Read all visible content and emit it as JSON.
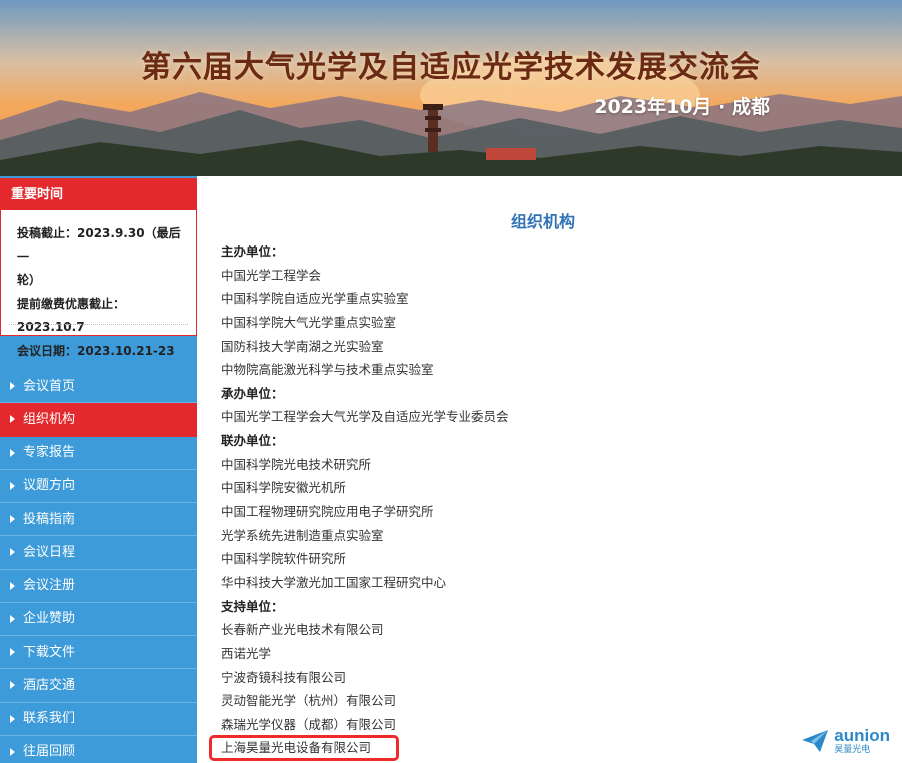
{
  "banner": {
    "title": "第六届大气光学及自适应光学技术发展交流会",
    "subtitle": "2023年10月 · 成都"
  },
  "important_dates": {
    "heading": "重要时间",
    "lines": [
      "投稿截止：2023.9.30（最后一",
      "轮）",
      "提前缴费优惠截止：2023.10.7",
      "会议日期：2023.10.21-23"
    ]
  },
  "menu": {
    "items": [
      {
        "label": "会议首页",
        "active": false
      },
      {
        "label": "组织机构",
        "active": true
      },
      {
        "label": "专家报告",
        "active": false
      },
      {
        "label": "议题方向",
        "active": false
      },
      {
        "label": "投稿指南",
        "active": false
      },
      {
        "label": "会议日程",
        "active": false
      },
      {
        "label": "会议注册",
        "active": false
      },
      {
        "label": "企业赞助",
        "active": false
      },
      {
        "label": "下载文件",
        "active": false
      },
      {
        "label": "酒店交通",
        "active": false
      },
      {
        "label": "联系我们",
        "active": false
      },
      {
        "label": "往届回顾",
        "active": false
      }
    ]
  },
  "main": {
    "title": "组织机构",
    "lines": [
      {
        "text": "主办单位：",
        "heading": true
      },
      {
        "text": "中国光学工程学会"
      },
      {
        "text": "中国科学院自适应光学重点实验室"
      },
      {
        "text": "中国科学院大气光学重点实验室"
      },
      {
        "text": "国防科技大学南湖之光实验室"
      },
      {
        "text": "中物院高能激光科学与技术重点实验室"
      },
      {
        "text": "承办单位：",
        "heading": true
      },
      {
        "text": "中国光学工程学会大气光学及自适应光学专业委员会"
      },
      {
        "text": "联办单位：",
        "heading": true
      },
      {
        "text": "中国科学院光电技术研究所"
      },
      {
        "text": "中国科学院安徽光机所"
      },
      {
        "text": "中国工程物理研究院应用电子学研究所"
      },
      {
        "text": "光学系统先进制造重点实验室"
      },
      {
        "text": "中国科学院软件研究所"
      },
      {
        "text": "华中科技大学激光加工国家工程研究中心"
      },
      {
        "text": "支持单位：",
        "heading": true
      },
      {
        "text": "长春新产业光电技术有限公司"
      },
      {
        "text": "西诺光学"
      },
      {
        "text": "宁波奇镜科技有限公司"
      },
      {
        "text": "灵动智能光学（杭州）有限公司"
      },
      {
        "text": "森瑞光学仪器（成都）有限公司"
      },
      {
        "text": "上海昊量光电设备有限公司",
        "highlight": true
      }
    ]
  },
  "watermark": {
    "word": "aunion",
    "cn": "昊量光电",
    "icon": "paper-plane-logo"
  },
  "colors": {
    "accent_red": "#e3292e",
    "menu_blue": "#3d9bd9",
    "title_blue": "#3273b5",
    "highlight_red": "#ee2a2a"
  }
}
